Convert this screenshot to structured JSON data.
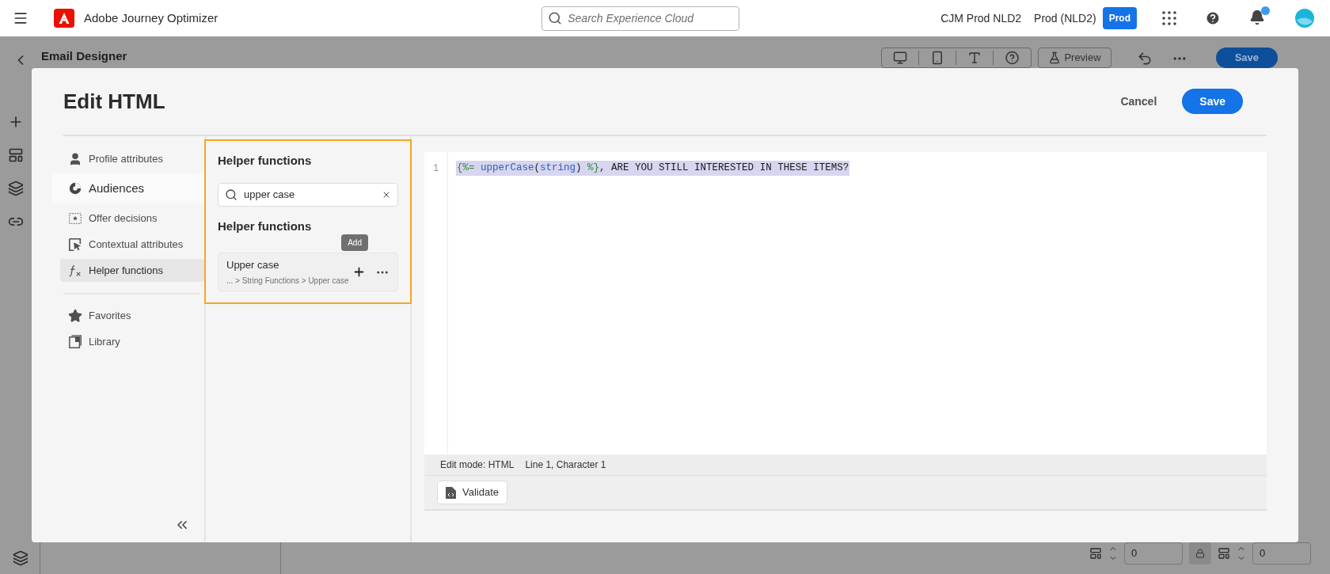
{
  "top_bar": {
    "app_name": "Adobe Journey Optimizer",
    "search": {
      "placeholder": "Search Experience Cloud"
    },
    "org": "CJM Prod NLD2",
    "sandbox": "Prod (NLD2)",
    "env_badge": "Prod",
    "notifications_unread": true
  },
  "background": {
    "title": "Email Designer",
    "preview": "Preview",
    "save": "Save",
    "fields": [
      "0",
      "0"
    ]
  },
  "modal": {
    "title": "Edit HTML",
    "cancel": "Cancel",
    "save": "Save",
    "nav_groups": [
      [
        {
          "label": "Profile attributes",
          "selected": false,
          "hovered": false
        },
        {
          "label": "Audiences",
          "selected": false,
          "hovered": true
        },
        {
          "label": "Offer decisions",
          "selected": false,
          "hovered": false
        },
        {
          "label": "Contextual attributes",
          "selected": false,
          "hovered": false
        },
        {
          "label": "Helper functions",
          "selected": true,
          "hovered": false
        }
      ],
      [
        {
          "label": "Favorites",
          "selected": false,
          "hovered": false
        },
        {
          "label": "Library",
          "selected": false,
          "hovered": false
        }
      ]
    ],
    "panel": {
      "title": "Helper functions",
      "search": {
        "value": "upper case"
      },
      "section": "Helper functions",
      "results": [
        {
          "name": "Upper case",
          "path": "... > String Functions > Upper case",
          "tooltip": "Add"
        }
      ]
    },
    "editor": {
      "lines": [
        {
          "number": "1",
          "selected": true,
          "tokens": [
            {
              "kind": "delim",
              "text": "{%="
            },
            {
              "kind": "fn",
              "text": " upperCase"
            },
            {
              "kind": "plain",
              "text": "("
            },
            {
              "kind": "fn",
              "text": "string"
            },
            {
              "kind": "plain",
              "text": ") "
            },
            {
              "kind": "delim",
              "text": "%}"
            },
            {
              "kind": "plain",
              "text": ", ARE YOU STILL INTERESTED IN THESE ITEMS?"
            }
          ]
        }
      ],
      "status": [
        "Edit mode: HTML",
        "Line 1, Character 1"
      ],
      "validate": "Validate"
    }
  }
}
